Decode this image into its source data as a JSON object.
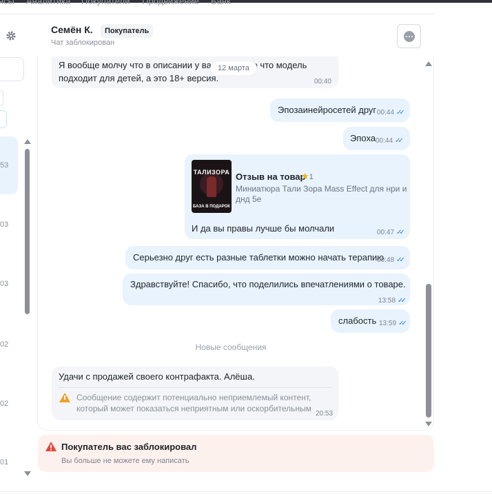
{
  "nav": {
    "items": [
      "ясы",
      "Аналитика",
      "Покупатели",
      "Продвижение",
      "Банк"
    ]
  },
  "sidebar": {
    "times": [
      "53",
      "03",
      "03",
      "02",
      "02",
      ".01"
    ]
  },
  "header": {
    "name": "Семён К.",
    "role_badge": "Покупатель",
    "status": "Чат заблокирован"
  },
  "messages": {
    "date_pill": "12 марта",
    "m1": {
      "line1": "Я вообще молчу что в описании у вас написано что модель",
      "line2": "подходит для детей, а это 18+ версия.",
      "time": "00:40"
    },
    "m2": {
      "text": "Эпозаинейросетей друг",
      "time": "00:44"
    },
    "m3": {
      "text": "Эпоха",
      "time": "00:44"
    },
    "m4": {
      "product_title": "Отзыв на товар",
      "rating": "1",
      "product_line1": "Миниатюра Тали Зора Mass Effect для нри и",
      "product_line2": "днд 5е",
      "image_caption_top": "ТАЛИЗОРА",
      "image_caption_bottom": "БАЗА В ПОДАРОК",
      "text": "И да вы правы лучше бы молчали",
      "time": "00:47"
    },
    "m5": {
      "text": "Серьезно друг есть разные таблетки можно начать терапию",
      "time": "00:48"
    },
    "m6": {
      "text": "Здравствуйте! Спасибо, что поделились впечатлениями о товаре.",
      "time": "13:58"
    },
    "m7": {
      "text": "слабость",
      "time": "13:59"
    },
    "new_divider": "Новые сообщения",
    "m8": {
      "text": "Удачи с продажей своего контрафакта. Алёша.",
      "warning_line1": "Сообщение содержит потенциально неприемлемый контент,",
      "warning_line2": "который может показаться неприятным или оскорбительным",
      "time": "20:53"
    }
  },
  "blocked": {
    "title": "Покупатель вас заблокировал",
    "subtitle": "Вы больше не можете ему написать"
  },
  "colors": {
    "incoming_bubble": "#f3f5f8",
    "outgoing_bubble": "#e8f3fd",
    "read_ticks": "#2b7ce9",
    "warning": "#f0a020",
    "error": "#e5443a",
    "blocked_bg": "#fdf1ee"
  },
  "icons": [
    "gear-icon",
    "more-icon",
    "read-ticks-icon",
    "star-icon",
    "warning-icon",
    "error-icon",
    "scroll-up-icon",
    "scroll-down-icon"
  ]
}
